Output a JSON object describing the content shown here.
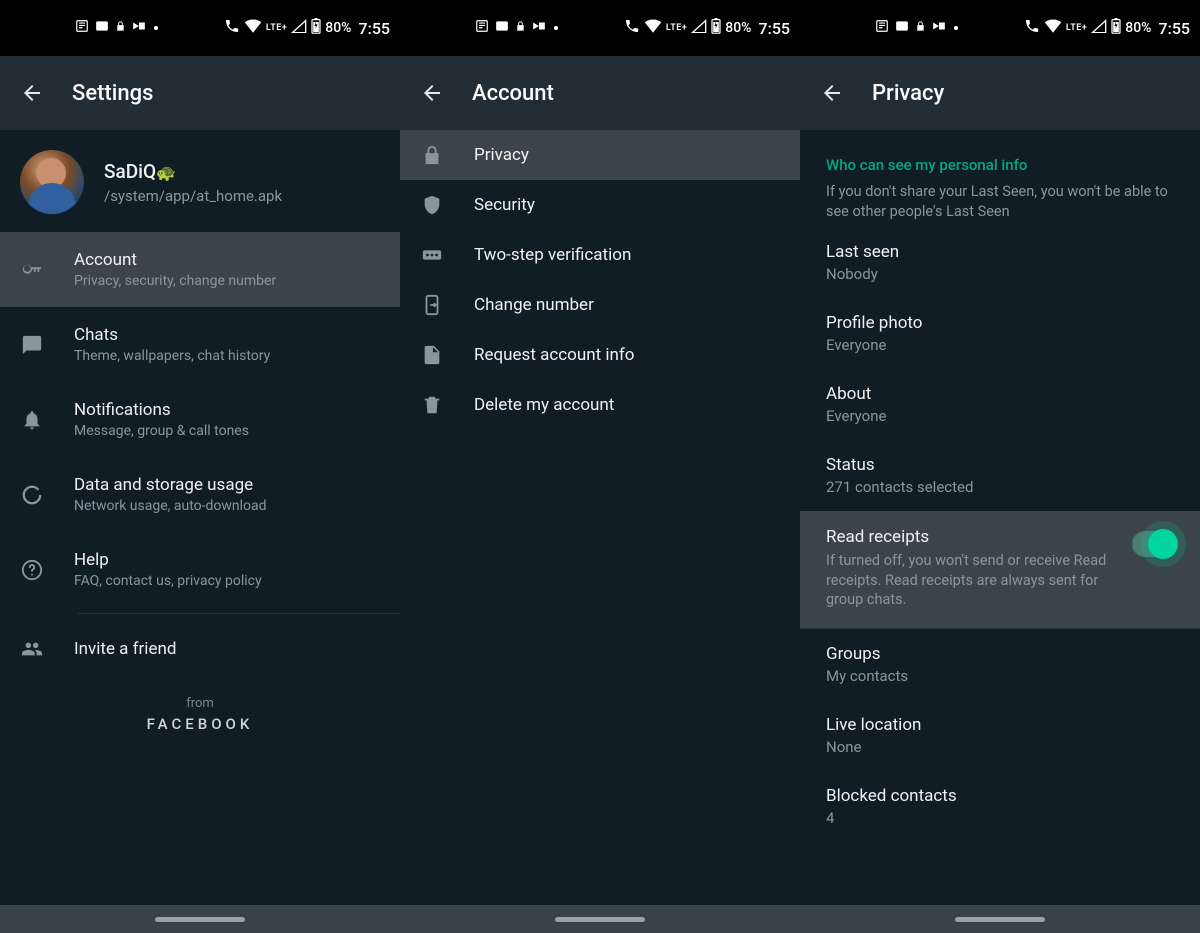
{
  "status": {
    "battery": "80%",
    "time": "7:55",
    "lte": "LTE+"
  },
  "screen1": {
    "title": "Settings",
    "profile": {
      "name": "SaDiQ",
      "sub": "/system/app/at_home.apk"
    },
    "items": [
      {
        "title": "Account",
        "sub": "Privacy, security, change number"
      },
      {
        "title": "Chats",
        "sub": "Theme, wallpapers, chat history"
      },
      {
        "title": "Notifications",
        "sub": "Message, group & call tones"
      },
      {
        "title": "Data and storage usage",
        "sub": "Network usage, auto-download"
      },
      {
        "title": "Help",
        "sub": "FAQ, contact us, privacy policy"
      }
    ],
    "invite": "Invite a friend",
    "from": "from",
    "facebook": "FACEBOOK"
  },
  "screen2": {
    "title": "Account",
    "items": [
      {
        "title": "Privacy"
      },
      {
        "title": "Security"
      },
      {
        "title": "Two-step verification"
      },
      {
        "title": "Change number"
      },
      {
        "title": "Request account info"
      },
      {
        "title": "Delete my account"
      }
    ]
  },
  "screen3": {
    "title": "Privacy",
    "section_title": "Who can see my personal info",
    "section_desc": "If you don't share your Last Seen, you won't be able to see other people's Last Seen",
    "items": [
      {
        "title": "Last seen",
        "value": "Nobody"
      },
      {
        "title": "Profile photo",
        "value": "Everyone"
      },
      {
        "title": "About",
        "value": "Everyone"
      },
      {
        "title": "Status",
        "value": "271 contacts selected"
      }
    ],
    "read_receipts": {
      "title": "Read receipts",
      "desc": "If turned off, you won't send or receive Read receipts. Read receipts are always sent for group chats.",
      "enabled": true
    },
    "items2": [
      {
        "title": "Groups",
        "value": "My contacts"
      },
      {
        "title": "Live location",
        "value": "None"
      },
      {
        "title": "Blocked contacts",
        "value": "4"
      }
    ]
  }
}
